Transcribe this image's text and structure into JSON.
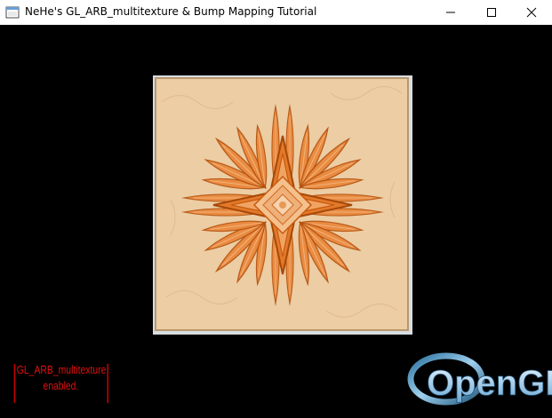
{
  "window": {
    "title": "NeHe's GL_ARB_multitexture & Bump Mapping Tutorial",
    "icon": "app-window-icon",
    "controls": [
      "minimize-icon",
      "maximize-icon",
      "close-icon"
    ]
  },
  "scene": {
    "background": "#000000",
    "texture_colors": {
      "base": "#efcfa6",
      "stroke": "#e0782e",
      "deep": "#c85a10",
      "frame": "#c9d3d8"
    }
  },
  "status": {
    "line1": "GL_ARB_multitexture",
    "line2": "enabled.",
    "color": "#e01010"
  },
  "logo": {
    "text": "OpenGL",
    "color": "#7fb2d6"
  }
}
